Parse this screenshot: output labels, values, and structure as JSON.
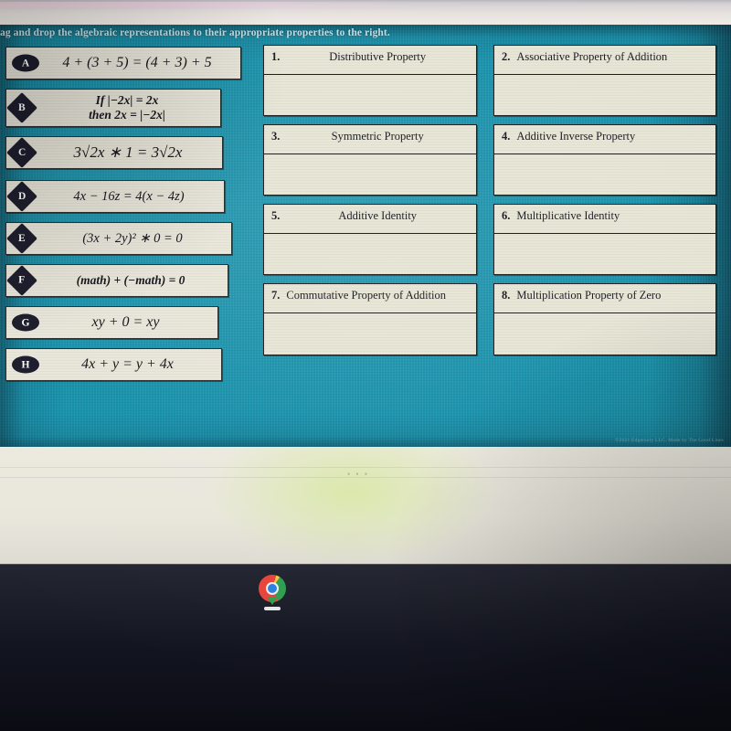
{
  "instructions": "ag and drop the algebraic representations to their appropriate properties to the right.",
  "tiles": [
    {
      "badge": "A",
      "shape": "oval",
      "equation": "4 + (3 + 5) = (4 + 3) + 5"
    },
    {
      "badge": "B",
      "shape": "diamond",
      "equation_line1": "If |−2x| = 2x",
      "equation_line2": "then 2x = |−2x|"
    },
    {
      "badge": "C",
      "shape": "diamond",
      "equation": "3√2x ∗ 1 = 3√2x"
    },
    {
      "badge": "D",
      "shape": "diamond",
      "equation": "4x − 16z = 4(x − 4z)"
    },
    {
      "badge": "E",
      "shape": "diamond",
      "equation": "(3x + 2y)² ∗ 0 = 0"
    },
    {
      "badge": "F",
      "shape": "diamond",
      "equation": "(math) + (−math) = 0"
    },
    {
      "badge": "G",
      "shape": "oval",
      "equation": "xy + 0 = xy"
    },
    {
      "badge": "H",
      "shape": "oval",
      "equation": "4x + y = y + 4x"
    }
  ],
  "properties": [
    {
      "num": "1.",
      "label": "Distributive Property"
    },
    {
      "num": "2.",
      "label": "Associative Property of Addition"
    },
    {
      "num": "3.",
      "label": "Symmetric Property"
    },
    {
      "num": "4.",
      "label": "Additive Inverse Property"
    },
    {
      "num": "5.",
      "label": "Additive Identity"
    },
    {
      "num": "6.",
      "label": "Multiplicative Identity"
    },
    {
      "num": "7.",
      "label": "Commutative Property of Addition"
    },
    {
      "num": "8.",
      "label": "Multiplication Property of Zero"
    }
  ],
  "copyright": "©2021 Edgenuity LLC. Made by The Good Lines",
  "page": {
    "ellipsis": "• • •"
  },
  "shelf": {
    "app_label": "Google Chrome"
  },
  "colors": {
    "worksheet_teal": "#1691ab",
    "tile_cream": "#e9e6da",
    "prop_cream": "#e7e6d6",
    "badge_navy": "#1b1b2b",
    "shelf_dark": "#121420"
  }
}
